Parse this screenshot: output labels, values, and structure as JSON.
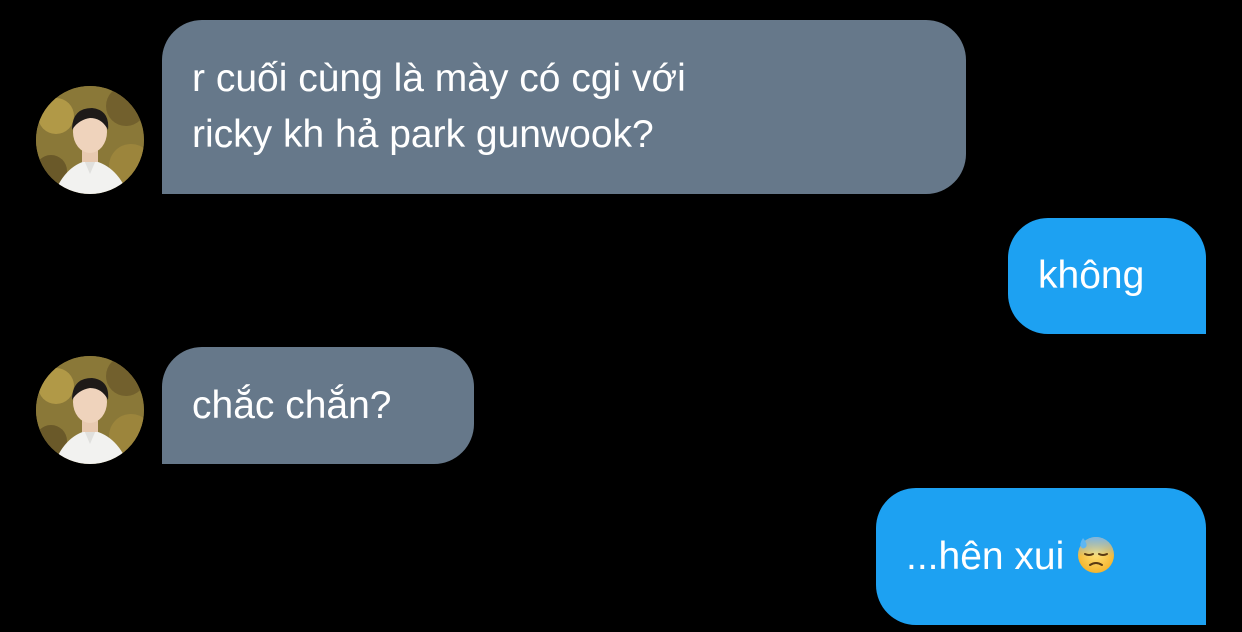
{
  "conversation": {
    "messages": [
      {
        "direction": "incoming",
        "text": "r cuối cùng là mày có cgi với\nricky kh hả park gunwook?"
      },
      {
        "direction": "outgoing",
        "text": "không"
      },
      {
        "direction": "incoming",
        "text": "chắc chắn?"
      },
      {
        "direction": "outgoing",
        "text": "...hên xui",
        "emoji": "downcast-face-with-sweat-emoji"
      }
    ]
  },
  "colors": {
    "background": "#000000",
    "incoming_bubble": "#66788a",
    "outgoing_bubble": "#1da1f2",
    "text": "#ffffff"
  },
  "icons": {
    "avatar": "profile-photo-avatar"
  }
}
